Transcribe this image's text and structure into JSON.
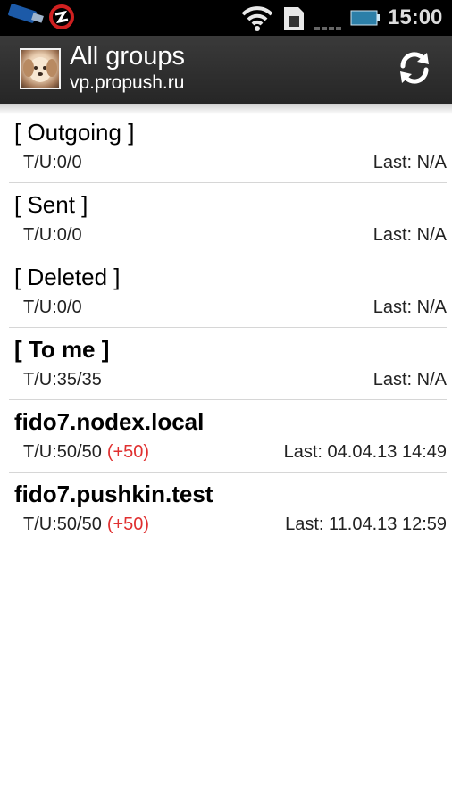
{
  "status_bar": {
    "icons": [
      "usb-icon",
      "app-notification-icon",
      "wifi-icon",
      "sim-card-icon",
      "signal-icon",
      "battery-icon"
    ],
    "time": "15:00"
  },
  "header": {
    "title": "All groups",
    "subtitle": "vp.propush.ru",
    "avatar_icon": "dog-avatar-icon",
    "refresh_icon": "refresh-icon"
  },
  "groups": [
    {
      "name": "[ Outgoing ]",
      "bold": false,
      "stats": "T/U:0/0",
      "new_count": "",
      "last": "Last: N/A"
    },
    {
      "name": "[ Sent ]",
      "bold": false,
      "stats": "T/U:0/0",
      "new_count": "",
      "last": "Last: N/A"
    },
    {
      "name": "[ Deleted ]",
      "bold": false,
      "stats": "T/U:0/0",
      "new_count": "",
      "last": "Last: N/A"
    },
    {
      "name": "[ To me ]",
      "bold": true,
      "stats": "T/U:35/35",
      "new_count": "",
      "last": "Last: N/A"
    },
    {
      "name": "fido7.nodex.local",
      "bold": true,
      "stats": "T/U:50/50",
      "new_count": "(+50)",
      "last": "Last: 04.04.13 14:49"
    },
    {
      "name": "fido7.pushkin.test",
      "bold": true,
      "stats": "T/U:50/50",
      "new_count": "(+50)",
      "last": "Last: 11.04.13 12:59"
    }
  ],
  "colors": {
    "new_count": "#e03030",
    "action_bar": "#2f2f2f",
    "divider": "#d6d6d6"
  }
}
